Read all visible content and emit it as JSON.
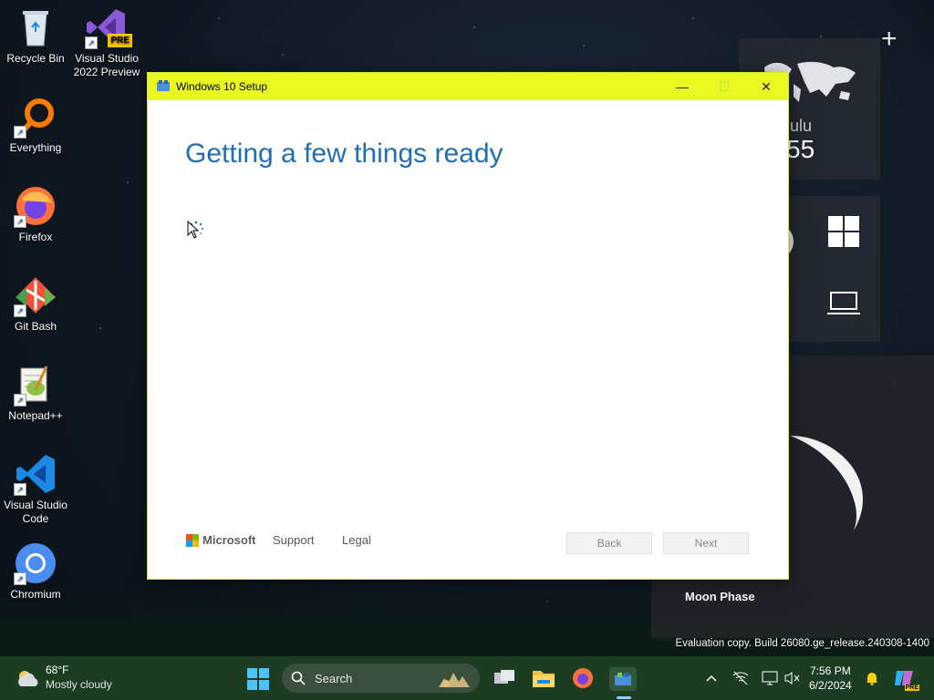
{
  "desktop": {
    "icons": [
      {
        "label": "Recycle Bin"
      },
      {
        "label": "Visual Studio 2022 Preview",
        "badge": "PRE"
      },
      {
        "label": "Everything"
      },
      {
        "label": "Firefox"
      },
      {
        "label": "Git Bash"
      },
      {
        "label": "Notepad++"
      },
      {
        "label": "Visual Studio Code"
      },
      {
        "label": "Chromium"
      }
    ]
  },
  "widgets": {
    "clock": {
      "city": "lulu",
      "time": "55"
    },
    "moon": {
      "label": "Moon Phase"
    },
    "add_symbol": "+"
  },
  "watermark": "Evaluation copy. Build 26080.ge_release.240308-1400",
  "setup_window": {
    "title": "Windows 10 Setup",
    "heading": "Getting a few things ready",
    "controls": {
      "minimize": "—",
      "maximize": "☐",
      "close": "✕"
    },
    "footer": {
      "brand": "Microsoft",
      "support": "Support",
      "legal": "Legal",
      "back": "Back",
      "next": "Next"
    },
    "titlebar_color": "#e8f821",
    "accent_color": "#1f6fb4"
  },
  "taskbar": {
    "weather": {
      "temp": "68°F",
      "desc": "Mostly cloudy"
    },
    "search_placeholder": "Search",
    "clock": {
      "time": "7:56 PM",
      "date": "6/2/2024"
    },
    "copilot_badge": "PRE"
  }
}
